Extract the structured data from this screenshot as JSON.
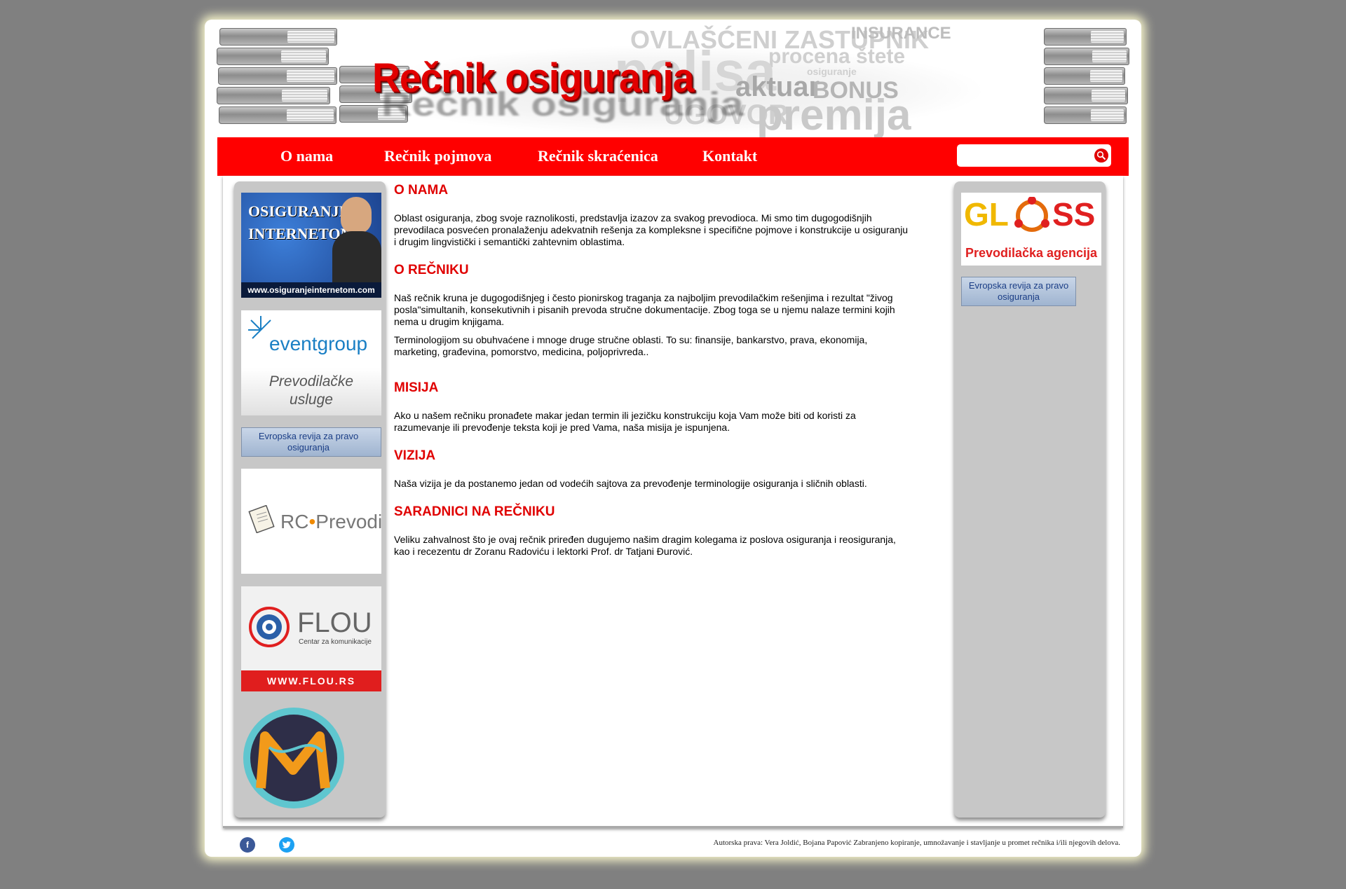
{
  "header": {
    "title": "Rečnik osiguranja",
    "watermark_words": [
      "OVLAŠĆENI ZASTUPNIK",
      "INSURANCE",
      "procena štete",
      "osiguranje",
      "polisa",
      "aktuar",
      "BONUS",
      "UGOVOR",
      "premija"
    ]
  },
  "nav": {
    "items": [
      {
        "label": "O nama"
      },
      {
        "label": "Rečnik pojmova"
      },
      {
        "label": "Rečnik skraćenica"
      },
      {
        "label": "Kontakt"
      }
    ],
    "search_placeholder": "",
    "search_icon": "search-icon"
  },
  "left_ads": {
    "osiguranje": {
      "line1": "OSIGURANJE",
      "line2": "INTERNETOM",
      "url": "www.osiguranjeinternetom.com"
    },
    "eventgroup": {
      "brand": "eventgroup",
      "line1": "Prevodilačke",
      "line2": "usluge"
    },
    "revija": {
      "line1": "Evropska revija za pravo",
      "line2": "osiguranja"
    },
    "rc": {
      "brand1": "RC",
      "brand2": "Prevodi"
    },
    "flou": {
      "brand": "FLOU",
      "tagline": "Centar za komunikacije",
      "url": "WWW.FLOU.RS"
    }
  },
  "right_ads": {
    "gloss": {
      "brand_left": "GL",
      "brand_right": "SS",
      "tagline": "Prevodilačka agencija"
    },
    "revija": {
      "line1": "Evropska revija za pravo",
      "line2": "osiguranja"
    }
  },
  "main": {
    "sections": [
      {
        "heading": "O NAMA",
        "paragraphs": [
          "Oblast osiguranja, zbog svoje raznolikosti, predstavlja izazov za svakog prevodioca. Mi smo tim dugogodišnjih prevodilaca posvećen pronalaženju adekvatnih rešenja za kompleksne i specifične pojmove i konstrukcije u osiguranju i drugim lingvistički i semantički zahtevnim oblastima."
        ]
      },
      {
        "heading": "O REČNIKU",
        "paragraphs": [
          "Naš rečnik kruna je dugogodišnjeg i često pionirskog traganja za najboljim prevodilačkim rešenjima i rezultat \"živog posla\"simultanih, konsekutivnih i pisanih prevoda stručne dokumentacije. Zbog toga se u njemu nalaze termini kojih nema u drugim knjigama.",
          "Terminologijom su obuhvaćene i mnoge druge stručne oblasti. To su: finansije, bankarstvo, prava, ekonomija, marketing, građevina, pomorstvo, medicina, poljoprivreda.."
        ]
      },
      {
        "heading": "MISIJA",
        "paragraphs": [
          "Ako u našem rečniku pronađete makar jedan termin ili jezičku konstrukciju koja Vam može biti od koristi za razumevanje ili prevođenje teksta koji je pred Vama, naša misija je ispunjena."
        ]
      },
      {
        "heading": "VIZIJA",
        "paragraphs": [
          "Naša vizija je da postanemo jedan od vodećih sajtova za prevođenje terminologije osiguranja i sličnih oblasti."
        ]
      },
      {
        "heading": "SARADNICI NA REČNIKU",
        "paragraphs": [
          "Veliku zahvalnost što je ovaj rečnik priređen dugujemo našim dragim kolegama iz poslova osiguranja i reosiguranja,  kao i recezentu dr Zoranu Radoviću i lektorki Prof. dr Tatjani Đurović."
        ]
      }
    ]
  },
  "footer": {
    "facebook": "f",
    "credits": "Autorska prava: Vera Joldić, Bojana Papović   Zabranjeno kopiranje, umnožavanje i stavljanje u promet rečnika i/ili njegovih delova."
  },
  "colors": {
    "accent": "#ff0000",
    "heading": "#e00000",
    "background": "#808080",
    "sidebar": "#c7c7c7"
  }
}
